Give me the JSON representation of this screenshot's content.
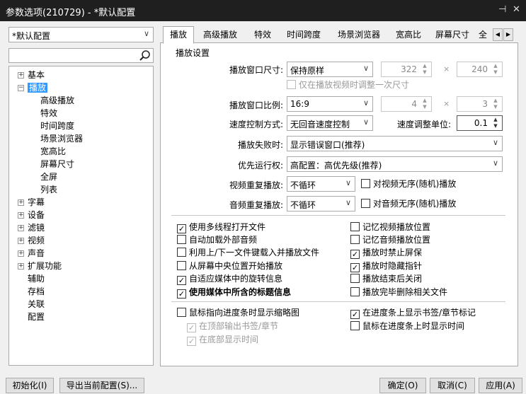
{
  "window": {
    "title": "参数选项(210729) - *默认配置",
    "pin": "⊣",
    "close": "✕"
  },
  "left": {
    "profile": "*默认配置",
    "search_placeholder": "",
    "tree": [
      {
        "label": "基本",
        "expander": "+"
      },
      {
        "label": "播放",
        "expander": "−"
      },
      {
        "label": "高级播放"
      },
      {
        "label": "特效"
      },
      {
        "label": "时间跨度"
      },
      {
        "label": "场景浏览器"
      },
      {
        "label": "宽高比"
      },
      {
        "label": "屏幕尺寸"
      },
      {
        "label": "全屏"
      },
      {
        "label": "列表"
      },
      {
        "label": "字幕",
        "expander": "+"
      },
      {
        "label": "设备",
        "expander": "+"
      },
      {
        "label": "滤镜",
        "expander": "+"
      },
      {
        "label": "视频",
        "expander": "+"
      },
      {
        "label": "声音",
        "expander": "+"
      },
      {
        "label": "扩展功能",
        "expander": "+"
      },
      {
        "label": "辅助"
      },
      {
        "label": "存档"
      },
      {
        "label": "关联"
      },
      {
        "label": "配置"
      }
    ]
  },
  "tabs": [
    "播放",
    "高级播放",
    "特效",
    "时间跨度",
    "场景浏览器",
    "宽高比",
    "屏幕尺寸",
    "全"
  ],
  "group_title": "播放设置",
  "fields": {
    "window_size_label": "播放窗口尺寸:",
    "window_size_value": "保持原样",
    "width": "322",
    "height": "240",
    "times": "×",
    "only_once": "仅在播放视频时调整一次尺寸",
    "ratio_label": "播放窗口比例:",
    "ratio_value": "16:9",
    "ratio_w": "4",
    "ratio_h": "3",
    "speed_label": "速度控制方式:",
    "speed_value": "无回音速度控制",
    "speed_unit_label": "速度调整单位:",
    "speed_unit_value": "0.1",
    "fail_label": "播放失败时:",
    "fail_value": "显示错误窗口(推荐)",
    "priority_label": "优先运行权:",
    "priority_value": "高配置：高优先级(推荐)",
    "video_repeat_label": "视频重复播放:",
    "video_repeat_value": "不循环",
    "video_shuffle": "对视频无序(随机)播放",
    "audio_repeat_label": "音频重复播放:",
    "audio_repeat_value": "不循环",
    "audio_shuffle": "对音频无序(随机)播放"
  },
  "checks_left": [
    {
      "label": "使用多线程打开文件",
      "checked": true
    },
    {
      "label": "自动加载外部音频",
      "checked": false
    },
    {
      "label": "利用上/下一文件键载入并播放文件",
      "checked": false
    },
    {
      "label": "从屏幕中央位置开始播放",
      "checked": false
    },
    {
      "label": "自适应媒体中的旋转信息",
      "checked": true
    },
    {
      "label": "使用媒体中所含的标题信息",
      "checked": true,
      "bold": true
    }
  ],
  "checks_right": [
    {
      "label": "记忆视频播放位置",
      "checked": false
    },
    {
      "label": "记忆音频播放位置",
      "checked": false
    },
    {
      "label": "播放时禁止屏保",
      "checked": true
    },
    {
      "label": "播放时隐藏指针",
      "checked": true
    },
    {
      "label": "播放结束后关闭",
      "checked": false
    },
    {
      "label": "播放完毕删除相关文件",
      "checked": false
    }
  ],
  "checks_bottom": {
    "thumbnail": {
      "label": "鼠标指向进度条时显示缩略图",
      "checked": false
    },
    "top_bookmark": {
      "label": "在顶部输出书签/章节",
      "checked": true
    },
    "bottom_time": {
      "label": "在底部显示时间",
      "checked": true
    },
    "show_marks": {
      "label": "在进度条上显示书签/章节标记",
      "checked": true
    },
    "hover_time": {
      "label": "鼠标在进度条上时显示时间",
      "checked": false
    }
  },
  "buttons": {
    "init": "初始化(I)",
    "export": "导出当前配置(S)...",
    "ok": "确定(O)",
    "cancel": "取消(C)",
    "apply": "应用(A)"
  }
}
